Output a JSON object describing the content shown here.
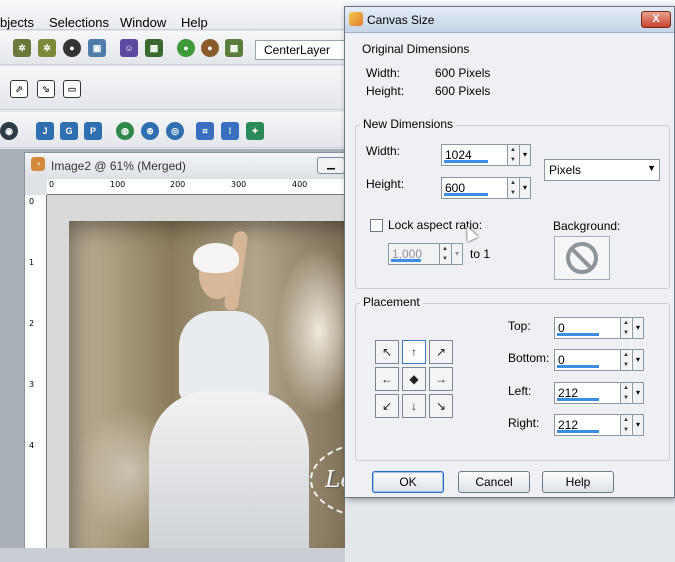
{
  "menubar": {
    "items": [
      "bjects",
      "Selections",
      "Window",
      "Help"
    ],
    "window_mnemonic": "W",
    "help_mnemonic": "H"
  },
  "toolbar": {
    "layer_combo_value": "CenterLayer",
    "icons": [
      "eye-icon",
      "cube-icon",
      "person-icon",
      "image-icon",
      "jpeg-icon",
      "gif-icon",
      "png-icon",
      "globe-icon"
    ]
  },
  "image_window": {
    "title": "Image2 @  61% (Merged)",
    "ruler_h_ticks": [
      "0",
      "100",
      "200",
      "300",
      "400"
    ],
    "ruler_v_ticks": [
      "0",
      "1",
      "2",
      "3",
      "4"
    ],
    "watermark": "LeilaMel"
  },
  "dialog": {
    "title": "Canvas Size",
    "close_label": "X",
    "original": {
      "group_label": "Original Dimensions",
      "width_label": "Width:",
      "width_value": "600 Pixels",
      "height_label": "Height:",
      "height_value": "600 Pixels"
    },
    "new": {
      "group_label": "New Dimensions",
      "width_label": "Width:",
      "width_value": "1024",
      "height_label": "Height:",
      "height_value": "600",
      "units_value": "Pixels",
      "lock_label": "Lock aspect ratio:",
      "lock_checked": false,
      "ratio_value": "1,000",
      "ratio_suffix": "to 1",
      "background_label": "Background:"
    },
    "placement": {
      "group_label": "Placement",
      "anchors": [
        "↖",
        "↑",
        "↗",
        "←",
        "◆",
        "→",
        "↙",
        "↓",
        "↘"
      ],
      "top_label": "Top:",
      "top_value": "0",
      "bottom_label": "Bottom:",
      "bottom_value": "0",
      "left_label": "Left:",
      "left_value": "212",
      "right_label": "Right:",
      "right_value": "212"
    },
    "buttons": {
      "ok": "OK",
      "cancel": "Cancel",
      "help": "Help"
    }
  }
}
